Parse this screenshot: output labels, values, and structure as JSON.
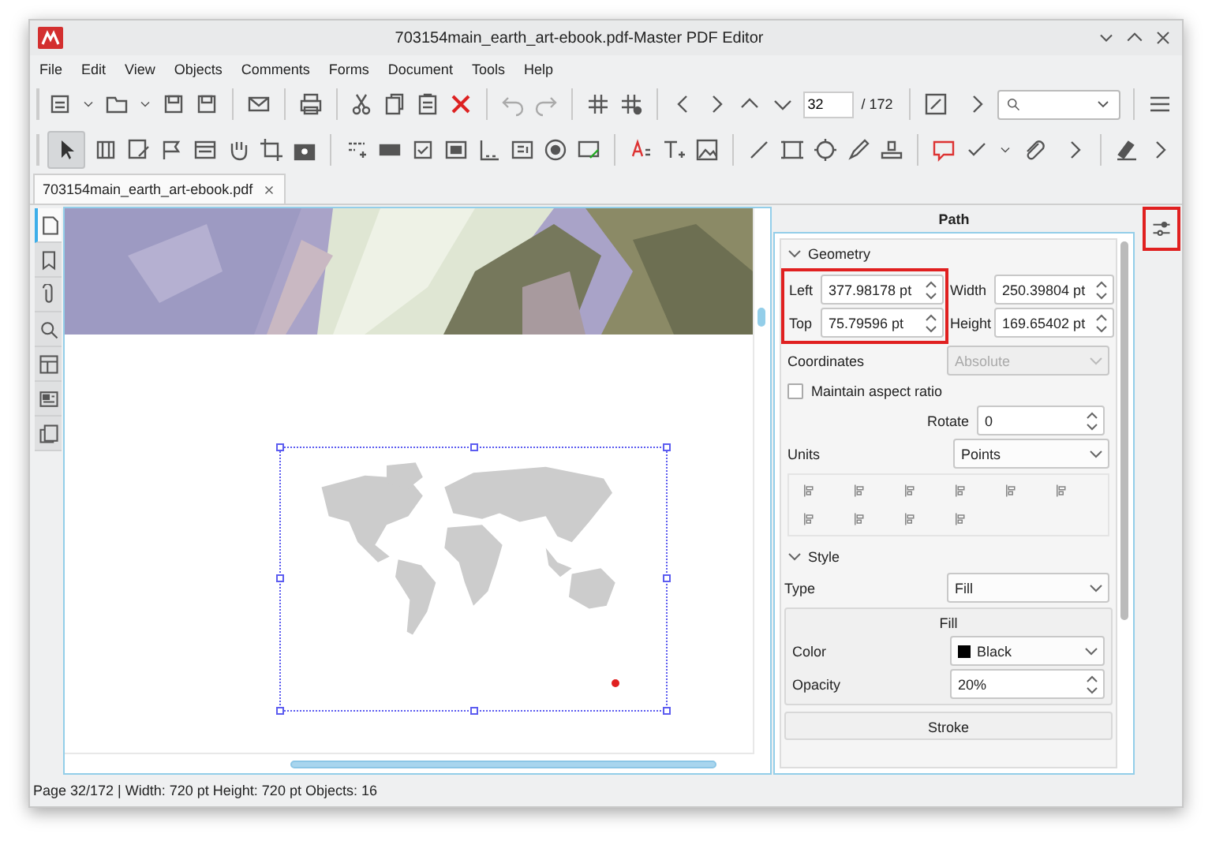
{
  "window": {
    "title": "703154main_earth_art-ebook.pdf-Master PDF Editor"
  },
  "menu": [
    "File",
    "Edit",
    "View",
    "Objects",
    "Comments",
    "Forms",
    "Document",
    "Tools",
    "Help"
  ],
  "toolbar": {
    "page_field": {
      "value": "32"
    },
    "page_total": "/ 172",
    "pointer_tool": {
      "selected": true
    }
  },
  "tabs": [
    {
      "label": "703154main_earth_art-ebook.pdf",
      "selected": true
    }
  ],
  "sidebar": {
    "items": [
      {
        "selected": true
      },
      {
        "selected": false
      },
      {
        "selected": false
      },
      {
        "selected": false
      },
      {
        "selected": false
      },
      {
        "selected": false
      },
      {
        "selected": false
      }
    ]
  },
  "properties": {
    "title": "Path",
    "geometry": {
      "label": "Geometry",
      "expanded": true,
      "highlighted": true,
      "left": {
        "label": "Left",
        "value": "377.98178 pt"
      },
      "top": {
        "label": "Top",
        "value": "75.79596 pt"
      },
      "width": {
        "label": "Width",
        "value": "250.39804 pt"
      },
      "height": {
        "label": "Height",
        "value": "169.65402 pt"
      },
      "coordinates": {
        "label": "Coordinates",
        "value": "Absolute",
        "disabled": true
      },
      "aspect": {
        "label": "Maintain aspect ratio",
        "checked": false
      },
      "rotate": {
        "label": "Rotate",
        "value": "0"
      },
      "units": {
        "label": "Units",
        "value": "Points"
      }
    },
    "style": {
      "label": "Style",
      "expanded": true,
      "type": {
        "label": "Type",
        "value": "Fill"
      },
      "fill": {
        "title": "Fill",
        "color": {
          "label": "Color",
          "value": "Black",
          "color": "#000000"
        },
        "opacity": {
          "label": "Opacity",
          "value": "20%"
        }
      },
      "stroke": {
        "title": "Stroke"
      }
    }
  },
  "panel_toggle": {
    "highlighted": true
  },
  "status_bar": "Page 32/172 | Width: 720 pt Height: 720 pt Objects: 16"
}
